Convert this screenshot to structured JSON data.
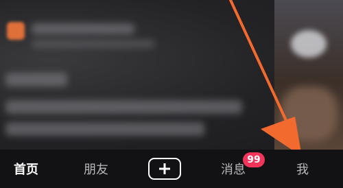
{
  "tabs": {
    "home": "首页",
    "friends": "朋友",
    "messages": "消息",
    "me": "我"
  },
  "badges": {
    "messages_count": "99"
  },
  "icons": {
    "add": "plus-icon",
    "annotation": "arrow-icon"
  },
  "colors": {
    "arrow": "#f26a2e",
    "badge": "#f2345a",
    "tab_bar": "#121214"
  }
}
